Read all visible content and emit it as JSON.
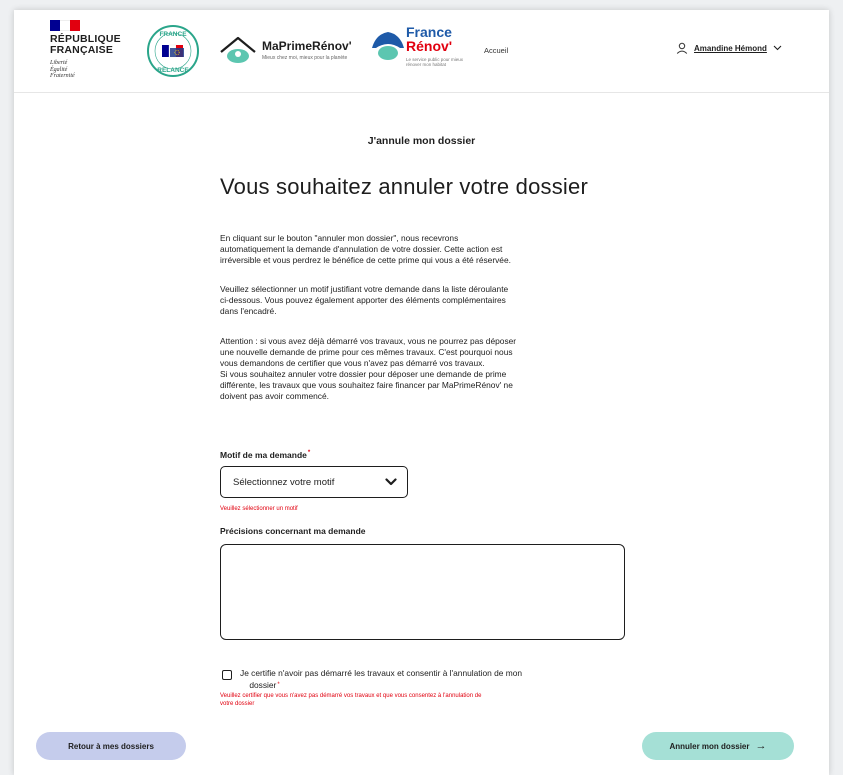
{
  "header": {
    "republique": [
      "RÉPUBLIQUE",
      "FRANÇAISE"
    ],
    "motto": [
      "Liberté",
      "Égalité",
      "Fraternité"
    ],
    "relance_logo_text": "FRANCE RELANCE",
    "mpr_name": "MaPrimeRénov'",
    "mpr_tagline": "Mieux chez moi, mieux pour la planète",
    "france_renov_line1": "France",
    "france_renov_line2": "Rénov'",
    "france_renov_tagline": "Le service public pour mieux rénover mon habitat",
    "nav_accueil": "Accueil",
    "user_name": "Amandine Hémond"
  },
  "main": {
    "kicker": "J'annule mon dossier",
    "title": "Vous souhaitez annuler votre dossier",
    "paragraph1": [
      "En cliquant sur le bouton \"annuler mon dossier\", nous recevrons",
      "automatiquement la demande d'annulation de votre dossier. Cette action est",
      "irréversible et vous perdrez le bénéfice de cette prime qui vous a été réservée."
    ],
    "paragraph2": [
      "Veuillez sélectionner un motif justifiant votre demande dans la liste déroulante",
      "ci-dessous. Vous pouvez également apporter des éléments complémentaires",
      "dans l'encadré."
    ],
    "paragraph3": [
      "Attention : si vous avez déjà démarré vos travaux, vous ne pourrez pas déposer",
      "une nouvelle demande de prime pour ces mêmes travaux. C'est pourquoi nous",
      "vous demandons de certifier que vous n'avez pas démarré vos travaux.",
      "Si vous souhaitez annuler votre dossier pour déposer une demande de prime",
      "différente, les travaux que vous souhaitez faire financer par MaPrimeRénov' ne",
      "doivent pas avoir commencé."
    ]
  },
  "form": {
    "motif_label": "Motif de ma demande",
    "required_mark": "*",
    "motif_placeholder": "Sélectionnez votre motif",
    "motif_error": "Veuillez sélectionner un motif",
    "precisions_label": "Précisions concernant ma demande",
    "precisions_value": "",
    "certify_label_line1": "Je certifie n'avoir pas démarré les travaux et consentir à l'annulation de mon",
    "certify_label_line2": "dossier",
    "certify_error": [
      "Veuillez certifier que vous n'avez pas démarré vos travaux et que vous consentez à l'annulation de",
      "votre dossier"
    ]
  },
  "footer": {
    "back_label": "Retour à mes dossiers",
    "cancel_label": "Annuler mon dossier",
    "cancel_arrow": "→"
  },
  "colors": {
    "back_button": "#c5ccec",
    "cancel_button": "#a5e0d6",
    "error": "#e1000f",
    "france_blue": "#000091"
  }
}
